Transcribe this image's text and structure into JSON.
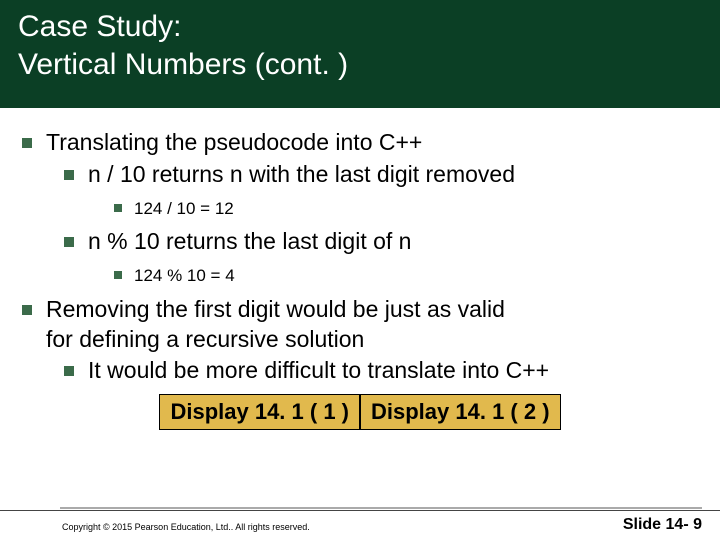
{
  "header": {
    "title_line1": "Case Study:",
    "title_line2": "Vertical Numbers  (cont. )"
  },
  "bullets": {
    "b1": "Translating the pseudocode into C++",
    "b1_1": "n / 10  returns n with the last digit removed",
    "b1_1_1": "124 / 10 = 12",
    "b1_2": "n % 10 returns the last digit of n",
    "b1_2_1": "124 % 10 = 4",
    "b2_a": "Removing the first digit would be just as valid",
    "b2_b": "for defining a recursive solution",
    "b2_1": "It would be more difficult to translate into C++"
  },
  "buttons": {
    "display1": "Display 14. 1 ( 1 )",
    "display2": "Display 14. 1 ( 2 )"
  },
  "footer": {
    "copyright": "Copyright © 2015 Pearson Education, Ltd..  All rights reserved.",
    "slide": "Slide 14- 9"
  }
}
